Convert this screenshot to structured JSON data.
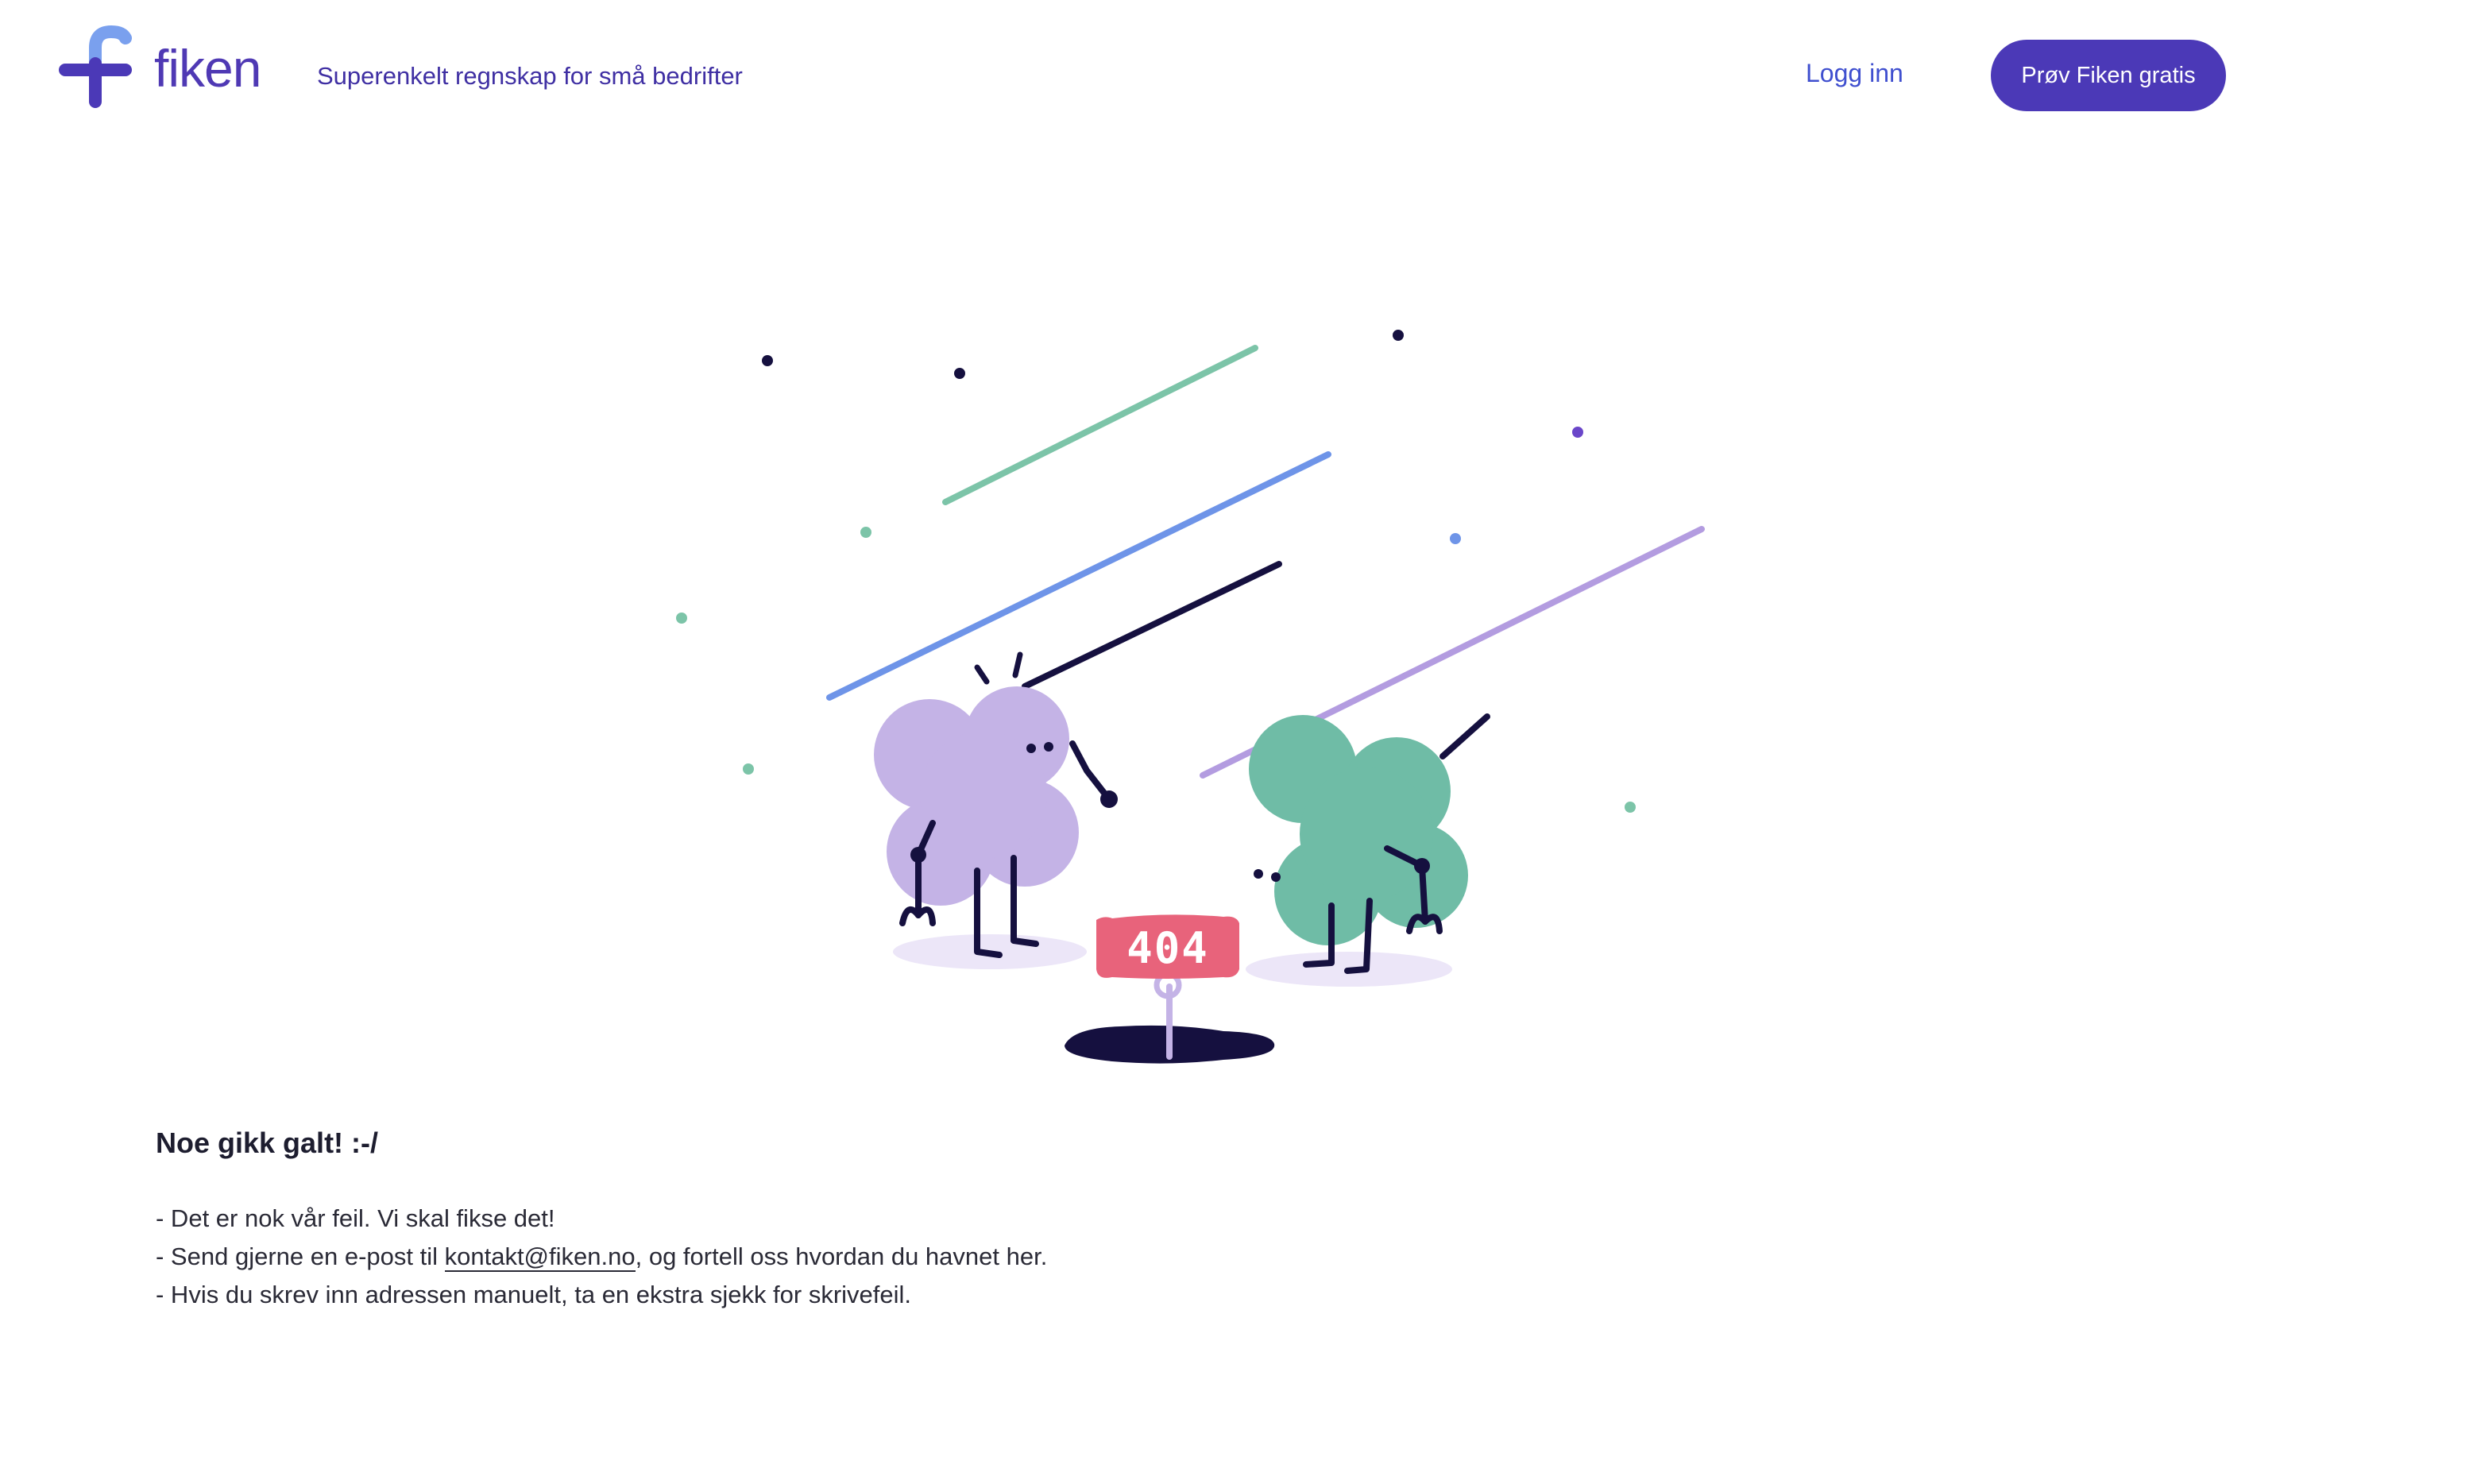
{
  "header": {
    "logo_text": "fiken",
    "tagline": "Superenkelt regnskap for små bedrifter",
    "login_label": "Logg inn",
    "cta_label": "Prøv Fiken gratis"
  },
  "illustration": {
    "badge_text": "404"
  },
  "message": {
    "heading": "Noe gikk galt! :-/",
    "line1": "- Det er nok vår feil. Vi skal fikse det!",
    "line2_prefix": "- Send gjerne en e-post til ",
    "line2_link": "kontakt@fiken.no",
    "line2_suffix": ", og fortell oss hvordan du havnet her.",
    "line3": "- Hvis du skrev inn adressen manuelt, ta en ekstra sjekk for skrivefeil."
  },
  "colors": {
    "brand_purple": "#4b39b7",
    "link_blue": "#3f4fcf",
    "badge_pink": "#e8637b",
    "character_lavender": "#c4b3e6",
    "character_green": "#6fbca6"
  },
  "icons": {
    "logo": "fiken-plus-logo-icon"
  }
}
